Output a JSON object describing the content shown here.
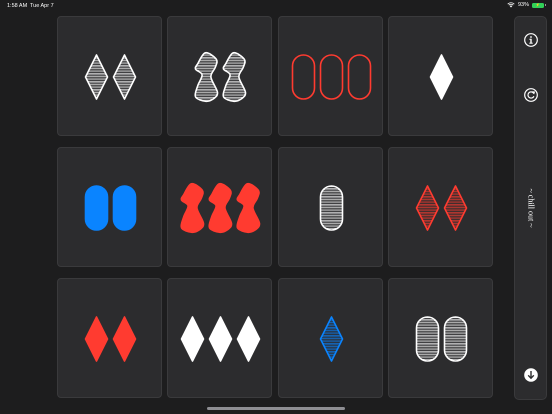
{
  "status_bar": {
    "time": "1:58 AM",
    "date": "Tue Apr 7",
    "battery_percent": "93%",
    "battery_icon": "battery-charging-icon",
    "wifi_icon": "wifi-icon"
  },
  "colors": {
    "background": "#1d1d1e",
    "card": "#2c2c2e",
    "card_border": "#3a3a3c",
    "white": "#ffffff",
    "red": "#ff3b30",
    "blue": "#0a84ff",
    "battery": "#30d158"
  },
  "board": {
    "rows": 3,
    "cols": 4,
    "cards": [
      {
        "count": 2,
        "shape": "diamond",
        "fill": "striped",
        "color": "white"
      },
      {
        "count": 2,
        "shape": "squiggle",
        "fill": "striped",
        "color": "white"
      },
      {
        "count": 3,
        "shape": "oval",
        "fill": "empty",
        "color": "red"
      },
      {
        "count": 1,
        "shape": "diamond",
        "fill": "solid",
        "color": "white"
      },
      {
        "count": 2,
        "shape": "oval",
        "fill": "solid",
        "color": "blue"
      },
      {
        "count": 3,
        "shape": "squiggle",
        "fill": "solid",
        "color": "red"
      },
      {
        "count": 1,
        "shape": "oval",
        "fill": "striped",
        "color": "white"
      },
      {
        "count": 2,
        "shape": "diamond",
        "fill": "striped",
        "color": "red"
      },
      {
        "count": 2,
        "shape": "diamond",
        "fill": "solid",
        "color": "red"
      },
      {
        "count": 3,
        "shape": "diamond",
        "fill": "solid",
        "color": "white"
      },
      {
        "count": 1,
        "shape": "diamond",
        "fill": "striped",
        "color": "blue"
      },
      {
        "count": 2,
        "shape": "oval",
        "fill": "striped",
        "color": "white"
      }
    ]
  },
  "side_panel": {
    "info_icon": "info-icon",
    "restart_icon": "restart-icon",
    "mode_label": "~ chill out ~",
    "deal_icon": "arrow-down-circle-icon"
  }
}
